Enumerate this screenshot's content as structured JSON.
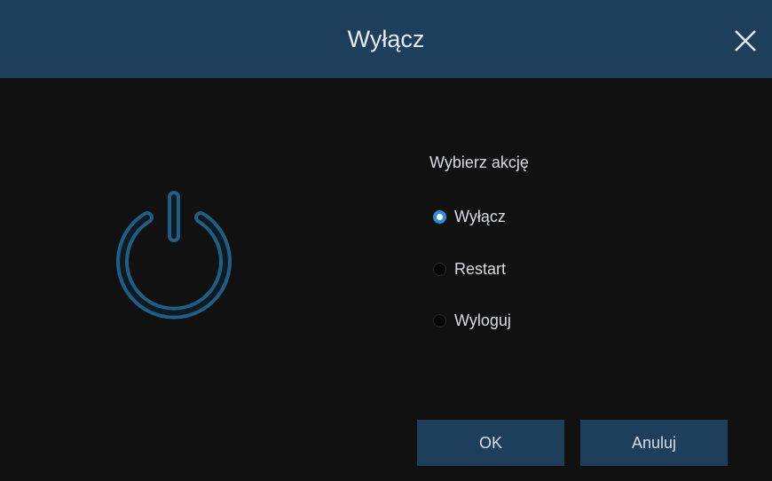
{
  "dialog": {
    "title": "Wyłącz",
    "close_icon": "close-icon",
    "power_icon": "power-icon"
  },
  "action": {
    "prompt": "Wybierz akcję",
    "options": [
      {
        "label": "Wyłącz",
        "checked": true
      },
      {
        "label": "Restart",
        "checked": false
      },
      {
        "label": "Wyloguj",
        "checked": false
      }
    ]
  },
  "buttons": {
    "ok": "OK",
    "cancel": "Anuluj"
  },
  "colors": {
    "titlebar": "#1e3f5c",
    "background": "#111111",
    "accent": "#2f8fd8",
    "power_icon": "#1f5f86"
  }
}
